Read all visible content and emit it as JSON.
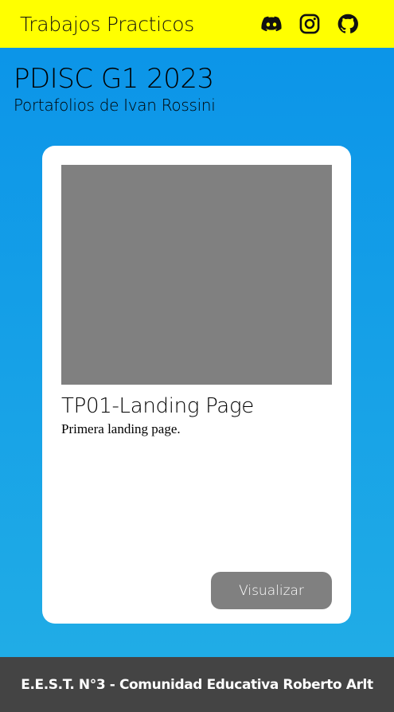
{
  "header": {
    "title": "Trabajos Practicos",
    "icons": [
      "discord-icon",
      "instagram-icon",
      "github-icon"
    ],
    "background": "#ffff00"
  },
  "hero": {
    "title": "PDISC G1 2023",
    "subtitle": "Portafolios de Ivan Rossini"
  },
  "card": {
    "title": "TP01-Landing Page",
    "description": "Primera landing page.",
    "button_label": "Visualizar",
    "image_placeholder_color": "#808080"
  },
  "footer": {
    "text": "E.E.S.T. N°3 - Comunidad Educativa Roberto Arlt",
    "background": "#444444"
  },
  "colors": {
    "gradient_top": "#0a93e8",
    "gradient_bottom": "#22aee6"
  }
}
